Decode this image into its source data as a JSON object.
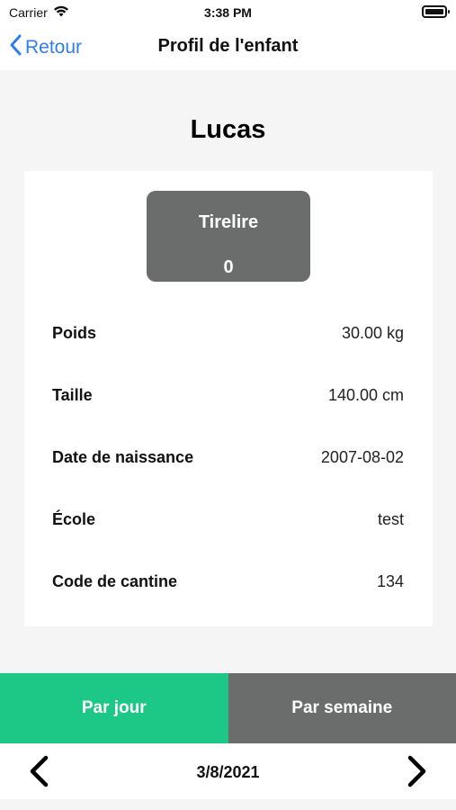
{
  "status_bar": {
    "carrier": "Carrier",
    "wifi_icon": "wifi-icon",
    "time": "3:38 PM",
    "battery_icon": "battery-icon"
  },
  "nav": {
    "back_label": "Retour",
    "back_icon": "chevron-left-icon",
    "title": "Profil de l'enfant",
    "accent_color": "#2f7cf6"
  },
  "profile": {
    "name": "Lucas",
    "piggy_bank": {
      "label": "Tirelire",
      "value": "0"
    },
    "details": [
      {
        "label": "Poids",
        "value": "30.00 kg"
      },
      {
        "label": "Taille",
        "value": "140.00 cm"
      },
      {
        "label": "Date de naissance",
        "value": "2007-08-02"
      },
      {
        "label": "École",
        "value": "test"
      },
      {
        "label": "Code de cantine",
        "value": "134"
      }
    ]
  },
  "tabs": {
    "day_label": "Par jour",
    "week_label": "Par semaine",
    "selected": "day",
    "day_color": "#1dc887",
    "week_color": "#6b6d6c"
  },
  "date_nav": {
    "date": "3/8/2021",
    "prev_icon": "chevron-left-icon",
    "next_icon": "chevron-right-icon"
  }
}
